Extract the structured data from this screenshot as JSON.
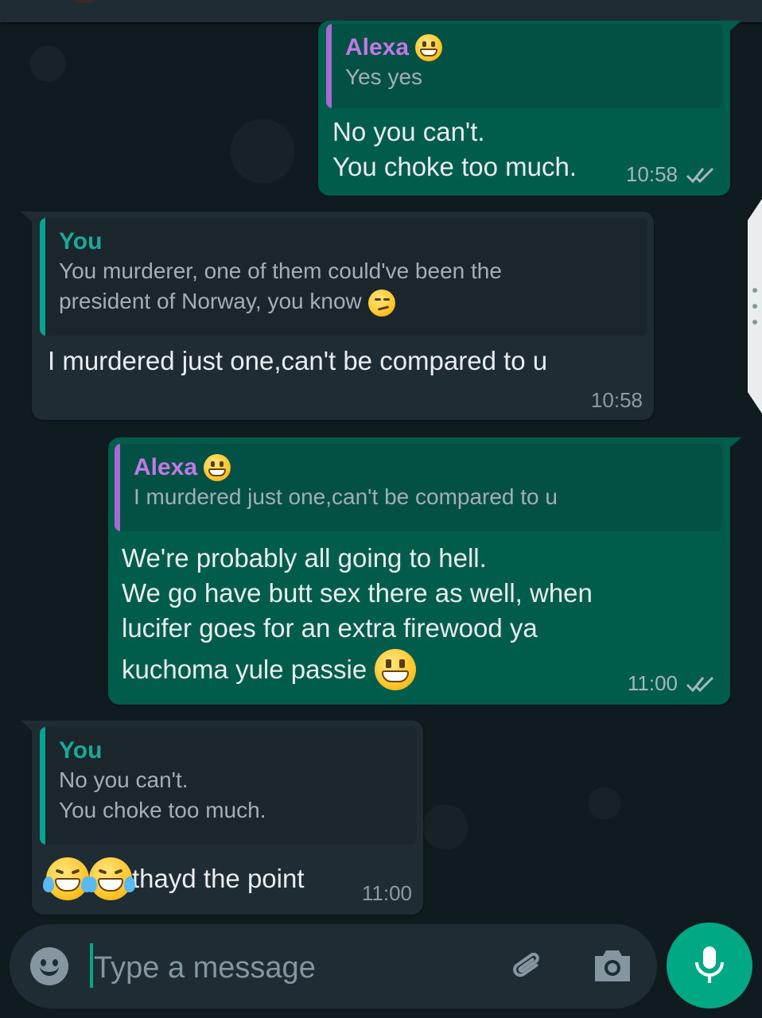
{
  "messages": [
    {
      "direction": "outgoing",
      "quote": {
        "author": "Alexa",
        "author_emoji": "grinning-face-icon",
        "text": "Yes yes"
      },
      "text": "No you can't.\nYou choke too much.",
      "time": "10:58",
      "status": "read"
    },
    {
      "direction": "incoming",
      "quote": {
        "author": "You",
        "text": "You murderer, one of them could've been the\npresident of Norway, you know",
        "text_emoji": "smirking-face-icon"
      },
      "text": "I murdered just one,can't be compared to u",
      "time": "10:58"
    },
    {
      "direction": "outgoing",
      "quote": {
        "author": "Alexa",
        "author_emoji": "grinning-face-icon",
        "text": "I murdered just one,can't be compared to u"
      },
      "text": "We're probably all going to hell.\nWe go have butt sex there as well, when\nlucifer goes for an extra firewood ya",
      "text_last_line": "kuchoma yule passie",
      "text_emoji": "grinning-face-icon",
      "time": "11:00",
      "status": "read"
    },
    {
      "direction": "incoming",
      "quote": {
        "author": "You",
        "text": "No you can't.\nYou choke too much."
      },
      "text_emojis": [
        "tears-of-joy-icon",
        "tears-of-joy-icon"
      ],
      "text": "thayd the point",
      "time": "11:00"
    }
  ],
  "composer": {
    "placeholder": "Type a message",
    "emoji_icon": "emoji-icon",
    "attach_icon": "paperclip-icon",
    "camera_icon": "camera-icon",
    "mic_icon": "mic-icon"
  },
  "colors": {
    "outgoing_bubble": "#005c4b",
    "incoming_bubble": "#1f2c34",
    "accent": "#00a884",
    "alexa_name": "#c279e7",
    "you_name": "#19a99a"
  }
}
